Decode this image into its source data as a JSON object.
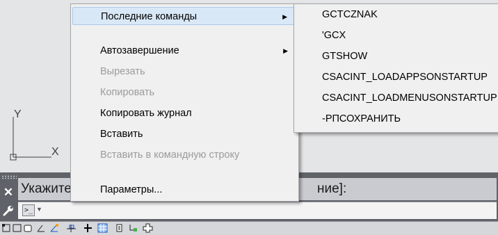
{
  "canvas": {
    "ucs": {
      "y_label": "Y",
      "x_label": "X"
    }
  },
  "command_line": {
    "prompt_start": "Укажите",
    "prompt_end": "ние]:",
    "input_value": ""
  },
  "context_menu": {
    "items": [
      {
        "label": "Последние команды",
        "enabled": true,
        "submenu": true,
        "highlighted": true
      },
      {
        "label": "Автозавершение",
        "enabled": true,
        "submenu": true
      },
      {
        "label": "Вырезать",
        "enabled": false
      },
      {
        "label": "Копировать",
        "enabled": false
      },
      {
        "label": "Копировать журнал",
        "enabled": true
      },
      {
        "label": "Вставить",
        "enabled": true
      },
      {
        "label": "Вставить в командную строку",
        "enabled": false
      },
      {
        "label": "Параметры...",
        "enabled": true
      }
    ]
  },
  "recent_commands_submenu": {
    "items": [
      "GCTCZNAK",
      "'GCX",
      "GTSHOW",
      "CSACINT_LOADAPPSONSTARTUP",
      "CSACINT_LOADMENUSONSTARTUP",
      "-РПСОХРАНИТЬ"
    ]
  },
  "colors": {
    "menu_bg": "#f0f0f0",
    "highlight": "#d9e8f7",
    "cmdline_bg": "#5f6268"
  },
  "icons": [
    "ucs-icon",
    "close-icon",
    "wrench-icon",
    "command-prompt-icon",
    "chevron-down-icon",
    "model-space-icon",
    "snap-icon",
    "grid-icon",
    "ortho-icon",
    "polar-icon",
    "osnap-icon",
    "lineweight-icon",
    "transparency-icon",
    "selection-cycling-icon",
    "dynamic-ucs-icon",
    "add-icon"
  ]
}
